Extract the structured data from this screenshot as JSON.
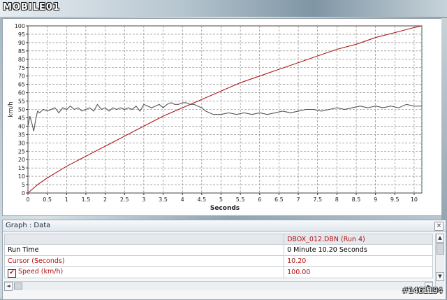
{
  "site_logo": {
    "text": "MOBILE01"
  },
  "watermark": "#1461194",
  "chart_data": {
    "type": "line",
    "xlabel": "Seconds",
    "ylabel": "km/h",
    "xlim": [
      0,
      10.2
    ],
    "ylim": [
      0,
      100
    ],
    "x_ticks": [
      "0",
      "0.5",
      "1",
      "1.5",
      "2",
      "2.5",
      "3",
      "3.5",
      "4",
      "4.5",
      "5",
      "5.5",
      "6",
      "6.5",
      "7",
      "7.5",
      "8",
      "8.5",
      "9",
      "9.5",
      "10"
    ],
    "y_ticks": [
      "0",
      "5",
      "10",
      "15",
      "20",
      "25",
      "30",
      "35",
      "40",
      "45",
      "50",
      "55",
      "60",
      "65",
      "70",
      "75",
      "80",
      "85",
      "90",
      "95",
      "100"
    ],
    "grid": true,
    "series": [
      {
        "color": "#b01818",
        "x": [
          0,
          0.25,
          0.5,
          1,
          1.5,
          2,
          2.5,
          3,
          3.5,
          4,
          4.5,
          5,
          5.5,
          6,
          6.5,
          7,
          7.5,
          8,
          8.5,
          9,
          9.5,
          10,
          10.2
        ],
        "y": [
          0,
          5,
          9,
          16,
          22,
          28,
          34,
          40,
          46,
          51,
          56,
          61,
          66,
          70,
          74,
          78,
          82,
          86,
          89,
          93,
          96,
          99,
          100
        ]
      },
      {
        "color": "#555555",
        "x": [
          0,
          0.05,
          0.1,
          0.15,
          0.2,
          0.25,
          0.3,
          0.4,
          0.5,
          0.6,
          0.7,
          0.8,
          0.9,
          1.0,
          1.1,
          1.2,
          1.3,
          1.4,
          1.5,
          1.6,
          1.7,
          1.8,
          1.9,
          2.0,
          2.1,
          2.2,
          2.3,
          2.4,
          2.5,
          2.6,
          2.7,
          2.8,
          2.9,
          3.0,
          3.1,
          3.2,
          3.3,
          3.4,
          3.5,
          3.6,
          3.7,
          3.8,
          3.9,
          4.0,
          4.1,
          4.2,
          4.3,
          4.4,
          4.5,
          4.6,
          4.7,
          4.8,
          4.9,
          5.0,
          5.2,
          5.4,
          5.6,
          5.8,
          6.0,
          6.2,
          6.4,
          6.6,
          6.8,
          7.0,
          7.2,
          7.4,
          7.6,
          7.8,
          8.0,
          8.2,
          8.4,
          8.6,
          8.8,
          9.0,
          9.2,
          9.4,
          9.6,
          9.8,
          10.0,
          10.2
        ],
        "y": [
          40,
          46,
          42,
          37,
          44,
          49,
          48,
          50,
          49,
          50,
          51,
          48,
          51,
          50,
          52,
          50,
          51,
          49,
          50,
          51,
          49,
          53,
          50,
          51,
          49,
          51,
          50,
          51,
          50,
          51,
          50,
          52,
          49,
          53,
          52,
          51,
          52,
          53,
          51,
          53,
          54,
          53,
          53,
          54,
          54,
          53,
          53,
          52,
          51,
          49,
          48,
          47,
          47,
          47,
          48,
          47,
          48,
          47,
          48,
          47,
          48,
          49,
          48,
          49,
          50,
          50,
          49,
          50,
          51,
          50,
          51,
          52,
          51,
          52,
          51,
          52,
          51,
          53,
          52,
          52
        ]
      }
    ]
  },
  "graph_data_panel": {
    "title": "Graph : Data",
    "close_glyph": "×",
    "columns": [
      "",
      "DBOX_012.DBN (Run 4)"
    ],
    "rows": [
      {
        "label": "Run Time",
        "value": "0 Minute 10.20 Seconds"
      },
      {
        "label": "Cursor (Seconds)",
        "value": "10.20"
      },
      {
        "label": "Speed (km/h)",
        "value": "100.00",
        "checked": true
      }
    ]
  }
}
